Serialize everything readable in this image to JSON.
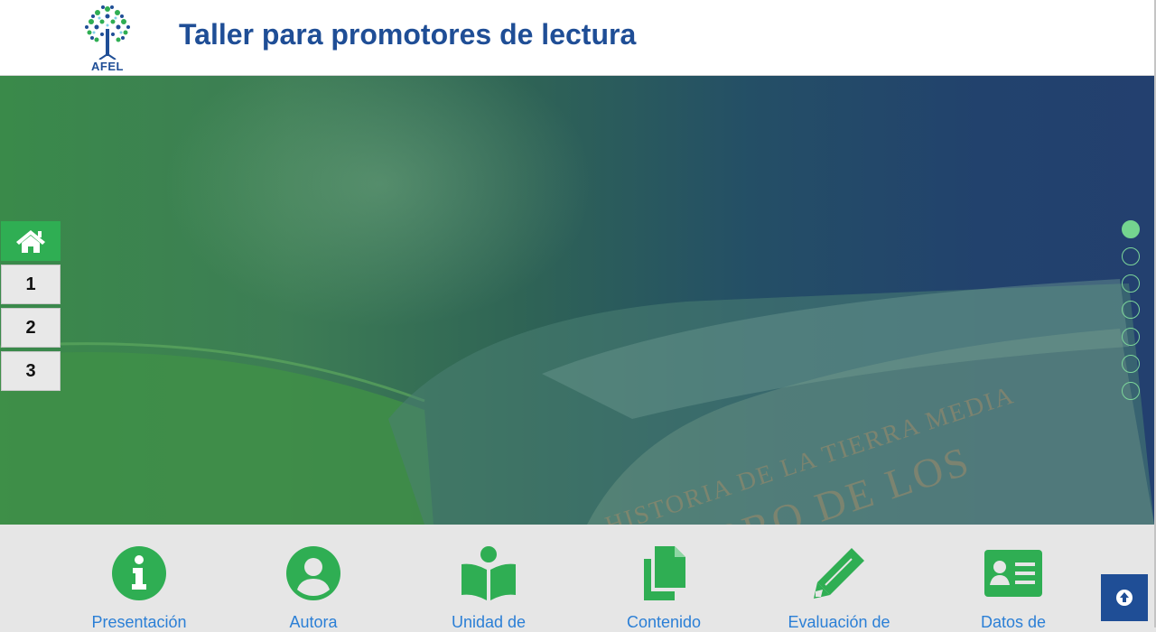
{
  "header": {
    "logo_text": "AFEL",
    "title": "Taller para promotores de lectura"
  },
  "side_nav": {
    "home_icon": "home-icon",
    "items": [
      "1",
      "2",
      "3"
    ]
  },
  "slider": {
    "dot_count": 7,
    "active_index": 0
  },
  "hero": {
    "book_text_line1": "HISTORIA DE LA TIERRA MEDIA",
    "book_text_line2": "LIBRO DE LOS"
  },
  "menu": {
    "items": [
      {
        "label": "Presentación",
        "icon": "info-icon"
      },
      {
        "label": "Autora",
        "icon": "user-icon"
      },
      {
        "label": "Unidad de",
        "icon": "reader-book-icon"
      },
      {
        "label": "Contenido",
        "icon": "copy-files-icon"
      },
      {
        "label": "Evaluación de",
        "icon": "pencil-icon"
      },
      {
        "label": "Datos de",
        "icon": "id-card-icon"
      }
    ]
  },
  "scroll_top": {
    "icon": "arrow-up-circle-icon"
  },
  "colors": {
    "brand_blue": "#1f4e96",
    "brand_green": "#2fae53",
    "link_blue": "#2b7fd6"
  }
}
